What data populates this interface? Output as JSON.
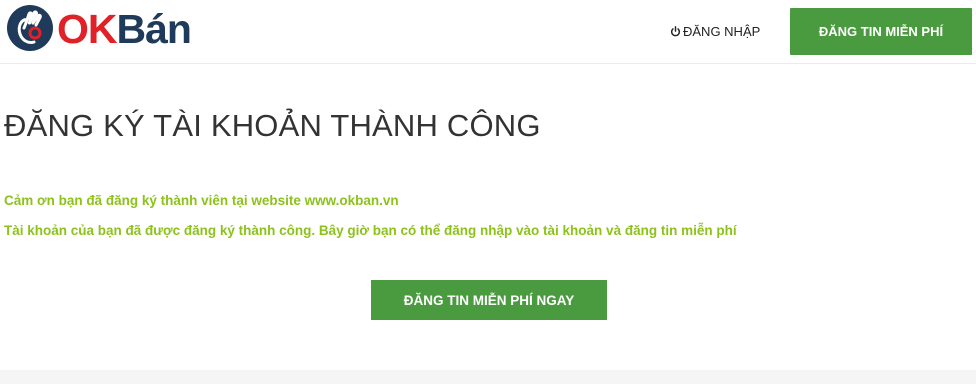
{
  "header": {
    "logo": {
      "part1": "OK",
      "part2": "Bán"
    },
    "login_label": "ĐĂNG NHẬP",
    "post_free_label": "ĐĂNG TIN MIỄN PHÍ"
  },
  "main": {
    "title": "ĐĂNG KÝ TÀI KHOẢN THÀNH CÔNG",
    "message_thanks": "Cảm ơn bạn đã đăng ký thành viên tại website www.okban.vn",
    "message_success": "Tài khoản của bạn đã được đăng ký thành công. Bây giờ bạn có thể đăng nhập vào tài khoản và đăng tin miễn phí",
    "cta_label": "ĐĂNG TIN MIỄN PHÍ NGAY"
  },
  "colors": {
    "brand_red": "#e02127",
    "brand_navy": "#1f3a5a",
    "button_green": "#4a9a3f",
    "message_green": "#8cc21a"
  },
  "icons": {
    "logo_mark": "ok-hand-gesture-icon",
    "login": "power-icon"
  }
}
